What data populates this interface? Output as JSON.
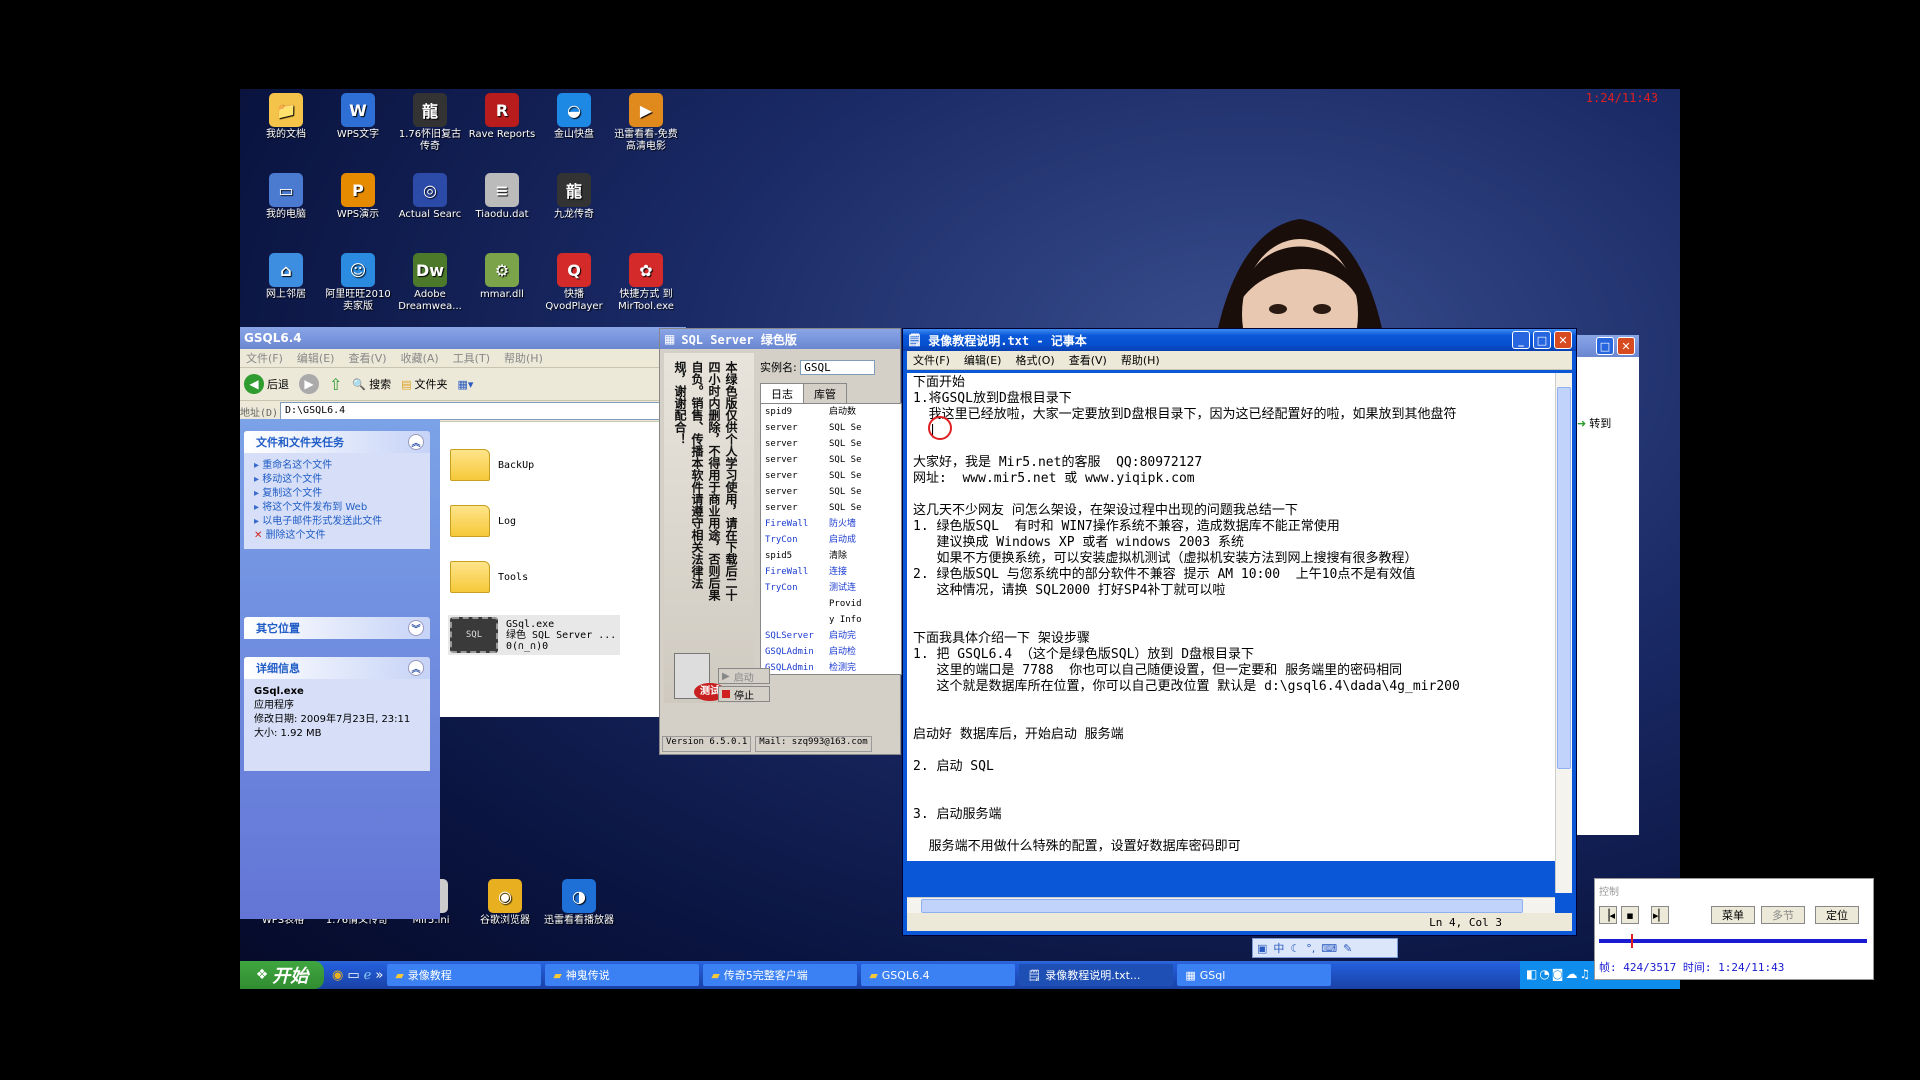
{
  "recorder_clock": "1:24/11:43",
  "desktop_icons": [
    {
      "label": "我的文档",
      "color": "#f3c34a",
      "glyph": "📁"
    },
    {
      "label": "WPS文字",
      "color": "#2e6fd6",
      "glyph": "W"
    },
    {
      "label": "1.76怀旧复古传奇",
      "color": "#333",
      "glyph": "龍"
    },
    {
      "label": "Rave Reports",
      "color": "#b81c1c",
      "glyph": "R"
    },
    {
      "label": "金山快盘",
      "color": "#1e88e5",
      "glyph": "◒"
    },
    {
      "label": "迅雷看看-免费高清电影",
      "color": "#e08a1e",
      "glyph": "▶"
    },
    {
      "label": "我的电脑",
      "color": "#4a7bd1",
      "glyph": "▭"
    },
    {
      "label": "WPS演示",
      "color": "#e68a00",
      "glyph": "P"
    },
    {
      "label": "Actual Searc",
      "color": "#2c4aa8",
      "glyph": "◎"
    },
    {
      "label": "Tiaodu.dat",
      "color": "#bbbbbb",
      "glyph": "≡"
    },
    {
      "label": "九龙传奇",
      "color": "#333",
      "glyph": "龍"
    },
    {
      "label": "网上邻居",
      "color": "#3d8ee0",
      "glyph": "⌂"
    },
    {
      "label": "阿里旺旺2010 卖家版",
      "color": "#2a8be0",
      "glyph": "☺"
    },
    {
      "label": "Adobe Dreamwea...",
      "color": "#4d7a2a",
      "glyph": "Dw"
    },
    {
      "label": "mmar.dll",
      "color": "#7aa34a",
      "glyph": "⚙"
    },
    {
      "label": "快播 QvodPlayer",
      "color": "#d42a2a",
      "glyph": "Q"
    },
    {
      "label": "快捷方式 到 MirTool.exe",
      "color": "#d42a2a",
      "glyph": "✿"
    }
  ],
  "bottom_icons": [
    {
      "label": "WPS表格",
      "color": "#3aa33a",
      "glyph": "S"
    },
    {
      "label": "1.76情义传奇",
      "color": "#333",
      "glyph": "龍"
    },
    {
      "label": "Mir5.ini",
      "color": "#cccccc",
      "glyph": "≡"
    },
    {
      "label": "谷歌浏览器",
      "color": "#e8b020",
      "glyph": "◉"
    },
    {
      "label": "迅雷看看播放器",
      "color": "#1e6fd6",
      "glyph": "◑"
    }
  ],
  "explorer": {
    "title": "GSQL6.4",
    "menus": [
      "文件(F)",
      "编辑(E)",
      "查看(V)",
      "收藏(A)",
      "工具(T)",
      "帮助(H)"
    ],
    "toolbar": {
      "back": "后退",
      "search": "搜索",
      "folders": "文件夹"
    },
    "address_label": "地址(D)",
    "address": "D:\\GSQL6.4",
    "task_panel_title": "文件和文件夹任务",
    "tasks": [
      "重命名这个文件",
      "移动这个文件",
      "复制这个文件",
      "将这个文件发布到 Web",
      "以电子邮件形式发送此文件",
      "删除这个文件"
    ],
    "other_panel_title": "其它位置",
    "detail_panel_title": "详细信息",
    "detail_name": "GSql.exe",
    "detail_type": "应用程序",
    "detail_modified": "修改日期: 2009年7月23日, 23:11",
    "detail_size": "大小: 1.92 MB",
    "folders": [
      "BackUp",
      "Log",
      "Tools"
    ],
    "exe_name": "GSql.exe",
    "exe_desc": "绿色 SQL Server ...",
    "exe_version": "0(∩_∩)0"
  },
  "sql_server": {
    "title": "SQL Server 绿色版",
    "instance_label": "实例名:",
    "instance": "GSQL",
    "tab_log": "日志",
    "tab_db": "库管",
    "log_sources": [
      "spid9",
      "server",
      "server",
      "server",
      "server",
      "server",
      "server",
      "FireWall",
      "TryCon",
      "spid5",
      "FireWall",
      "TryCon",
      "",
      "",
      "SQLServer",
      "GSQLAdmin",
      "GSQLAdmin"
    ],
    "log_msgs": [
      "启动数",
      "SQL Se",
      "SQL Se",
      "SQL Se",
      "SQL Se",
      "SQL Se",
      "SQL Se",
      "防火墙",
      "启动成",
      "清除",
      "连接",
      "测试连",
      "Provid",
      "y Info",
      "启动完",
      "启动检",
      "检测完"
    ],
    "side_text": "本绿色版仅供个人学习使用，请在下载后二十四小时内删除，不得用于商业用途，否则后果自负。销售、传播本软件请遵守相关法律法规，谢谢配合！",
    "start_btn": "启动",
    "stop_btn": "停止",
    "test_label": "测试",
    "version": "Version 6.5.0.1",
    "mail": "Mail: szq993@163.com"
  },
  "notepad": {
    "title": "录像教程说明.txt - 记事本",
    "menus": [
      "文件(F)",
      "编辑(E)",
      "格式(O)",
      "查看(V)",
      "帮助(H)"
    ],
    "lines": [
      "下面开始",
      "1.将GSQL放到D盘根目录下",
      "  我这里已经放啦，大家一定要放到D盘根目录下，因为这已经配置好的啦，如果放到其他盘符",
      "  |",
      "",
      "大家好，我是 Mir5.net的客服  QQ:80972127",
      "网址:  www.mir5.net 或 www.yiqipk.com",
      "",
      "这几天不少网友 问怎么架设，在架设过程中出现的问题我总结一下",
      "1. 绿色版SQL  有时和 WIN7操作系统不兼容，造成数据库不能正常使用",
      "   建议换成 Windows XP 或者 windows 2003 系统",
      "   如果不方便换系统，可以安装虚拟机测试（虚拟机安装方法到网上搜搜有很多教程）",
      "2. 绿色版SQL 与您系统中的部分软件不兼容 提示 AM 10:00  上午10点不是有效值",
      "   这种情况，请换 SQL2000 打好SP4补丁就可以啦",
      "",
      "",
      "下面我具体介绍一下 架设步骤",
      "1. 把 GSQL6.4 （这个是绿色版SQL）放到 D盘根目录下",
      "   这里的端口是 7788  你也可以自己随便设置，但一定要和 服务端里的密码相同",
      "   这个就是数据库所在位置，你可以自己更改位置 默认是 d:\\gsql6.4\\dada\\4g_mir200",
      "",
      "",
      "启动好 数据库后，开始启动 服务端",
      "",
      "2. 启动 SQL",
      "",
      "",
      "3. 启动服务端",
      "",
      "  服务端不用做什么特殊的配置，设置好数据库密码即可"
    ],
    "status": "Ln 4, Col 3"
  },
  "behind_window": {
    "goto": "转到"
  },
  "taskbar": {
    "start": "开始",
    "tasks": [
      "录像教程",
      "神鬼传说",
      "传奇5完整客户端",
      "GSQL6.4",
      "录像教程说明.txt...",
      "GSql"
    ]
  },
  "ime_bar": "中",
  "recorder": {
    "title": "控制",
    "btn_menu": "菜单",
    "btn_section": "多节",
    "btn_locate": "定位",
    "progress": 0.12,
    "status": "帧: 424/3517 时间: 1:24/11:43"
  },
  "colors": {
    "xp_blue": "#0a58d8",
    "start_green": "#3a9a3a",
    "accent_red": "#e02020"
  }
}
